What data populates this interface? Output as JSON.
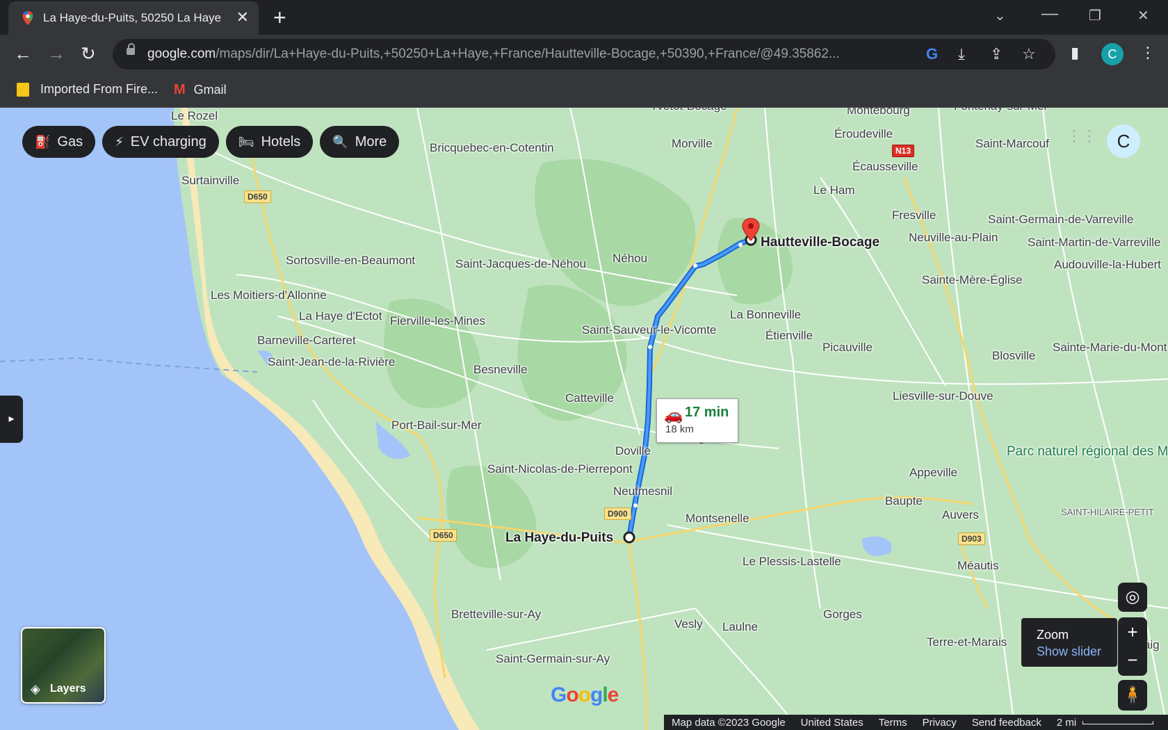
{
  "browser": {
    "tab_title": "La Haye-du-Puits, 50250 La Haye",
    "url_host": "google.com",
    "url_path": "/maps/dir/La+Haye-du-Puits,+50250+La+Haye,+France/Hautteville-Bocage,+50390,+France/@49.35862...",
    "profile_initial": "C",
    "bookmarks": [
      {
        "label": "Imported From Fire..."
      },
      {
        "label": "Gmail"
      }
    ]
  },
  "map": {
    "chips": [
      {
        "label": "Gas",
        "icon": "gas-icon"
      },
      {
        "label": "EV charging",
        "icon": "ev-charging-icon"
      },
      {
        "label": "Hotels",
        "icon": "hotel-icon"
      },
      {
        "label": "More",
        "icon": "search-icon"
      }
    ],
    "account_initial": "C",
    "route": {
      "time": "17 min",
      "distance": "18 km"
    },
    "origin": "La Haye-du-Puits",
    "destination": "Hautteville-Bocage",
    "places": [
      "Le Rozel",
      "Yvetot-Bocage",
      "Montebourg",
      "Fontenay-sur-Mer",
      "Surtainville",
      "Bricquebec-en-Cotentin",
      "Morville",
      "Éroudeville",
      "Saint-Marcouf",
      "Écausseville",
      "Le Ham",
      "Fresville",
      "Saint-Germain-de-Varreville",
      "Neuville-au-Plain",
      "Saint-Martin-de-Varreville",
      "Sortosville-en-Beaumont",
      "Saint-Jacques-de-Néhou",
      "Néhou",
      "Audouville-la-Hubert",
      "Les Moitiers-d'Allonne",
      "Sainte-Mère-Église",
      "La Haye d'Ectot",
      "Fierville-les-Mines",
      "La Bonneville",
      "Saint-Sauveur-le-Vicomte",
      "Barneville-Carteret",
      "Étienville",
      "Picauville",
      "Sainte-Marie-du-Mont",
      "Saint-Jean-de-la-Rivière",
      "Besneville",
      "Blosville",
      "Catteville",
      "Liesville-sur-Douve",
      "Port-Bail-sur-Mer",
      "Varenguebec",
      "Doville",
      "Saint-Nicolas-de-Pierrepont",
      "Appeville",
      "Neufmesnil",
      "Baupte",
      "Auvers",
      "SAINT-HILAIRE-PETIT",
      "Montsenelle",
      "Le Plessis-Lastelle",
      "Méautis",
      "Bretteville-sur-Ay",
      "Vesly",
      "Laulne",
      "Gorges",
      "Terre-et-Marais",
      "Graig",
      "Saint-Germain-sur-Ay"
    ],
    "park": "Parc naturel régional des Marais du Cotentin et...",
    "roads": [
      "D650",
      "D650",
      "D900",
      "D903",
      "N13"
    ],
    "layers_label": "Layers",
    "zoom_tooltip": {
      "title": "Zoom",
      "link": "Show slider"
    },
    "footer": [
      "Map data ©2023 Google",
      "United States",
      "Terms",
      "Privacy",
      "Send feedback",
      "2 mi"
    ],
    "logo": "Google"
  }
}
